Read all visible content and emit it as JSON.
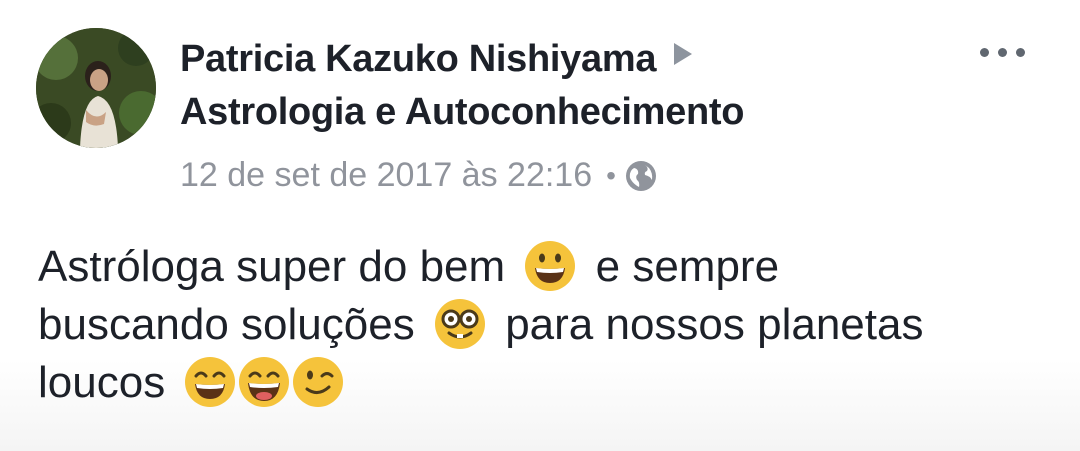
{
  "post": {
    "author_name": "Patricia Kazuko Nishiyama",
    "group_name": "Astrologia e Autoconhecimento",
    "timestamp": "12 de set de 2017 às 22:16",
    "separator": "•",
    "privacy_icon": "globe-icon",
    "more_icon": "more-options-icon",
    "text": {
      "line1_part1": "Astróloga super do bem",
      "line1_part2": "e sempre",
      "line2_part1": "buscando soluções",
      "line2_part2": "para nossos planetas",
      "line3_part1": "loucos"
    },
    "emojis": [
      "grinning-face",
      "nerd-face",
      "smiling-face-closed-eyes",
      "grinning-squinting-face",
      "winking-face"
    ]
  },
  "colors": {
    "name_text": "#1d2129",
    "meta_text": "#90949c",
    "emoji_yellow": "#f5c33b"
  }
}
